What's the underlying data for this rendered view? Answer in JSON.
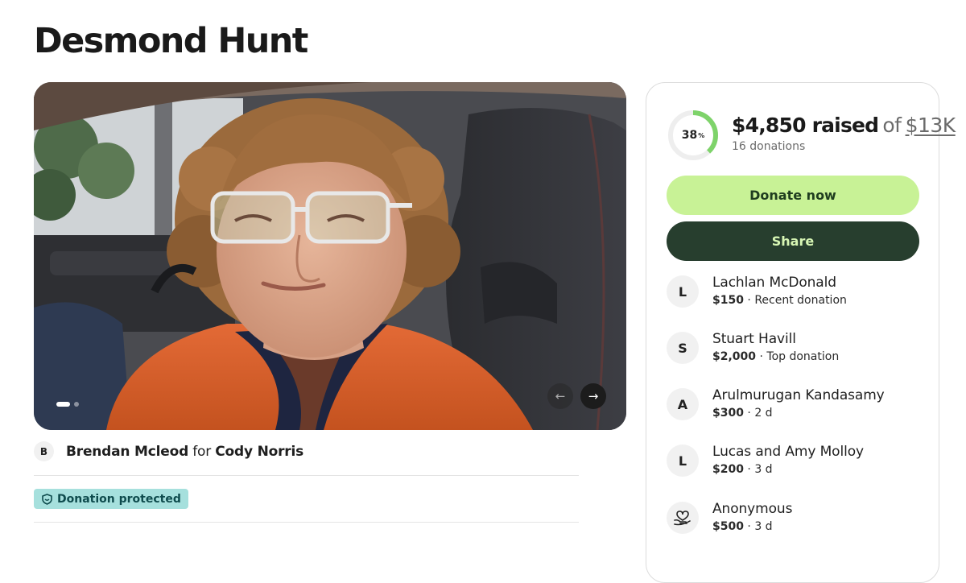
{
  "page": {
    "title": "Desmond Hunt"
  },
  "carousel": {
    "slides": 2,
    "active_slide": 1,
    "prev_icon": "arrow-left-icon",
    "next_icon": "arrow-right-icon",
    "prev_glyph": "←",
    "next_glyph": "→"
  },
  "organizer": {
    "initial": "B",
    "name": "Brendan Mcleod",
    "connector": "for",
    "beneficiary": "Cody Norris"
  },
  "badge": {
    "label": "Donation protected",
    "icon": "shield-icon"
  },
  "summary": {
    "percent": "38",
    "percent_sign": "%",
    "progress_fraction": 0.38,
    "raised": "$4,850 raised",
    "of": "of",
    "goal": "$13K",
    "donations": "16 donations"
  },
  "buttons": {
    "donate": "Donate now",
    "share": "Share"
  },
  "donors": [
    {
      "initial": "L",
      "name": "Lachlan McDonald",
      "amount": "$150",
      "note": "Recent donation"
    },
    {
      "initial": "S",
      "name": "Stuart Havill",
      "amount": "$2,000",
      "note": "Top donation"
    },
    {
      "initial": "A",
      "name": "Arulmurugan Kandasamy",
      "amount": "$300",
      "note": "2 d"
    },
    {
      "initial": "L",
      "name": "Lucas and Amy Molloy",
      "amount": "$200",
      "note": "3 d"
    },
    {
      "initial": "",
      "icon": "heart-hand-icon",
      "name": "Anonymous",
      "amount": "$500",
      "note": "3 d"
    }
  ],
  "meta_separator": " · ",
  "colors": {
    "progress": "#7ed36a",
    "progress_track": "#eeeeee",
    "donate_bg": "#c8f296",
    "share_bg": "#273e2e",
    "badge_bg": "#a6e0dd",
    "badge_text": "#0e4b4d"
  }
}
